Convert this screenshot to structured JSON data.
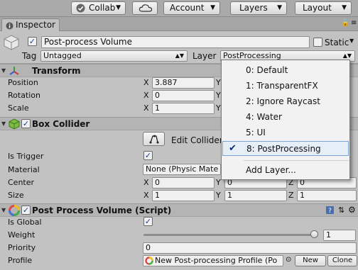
{
  "toolbar": {
    "collab_label": "Collab",
    "account_label": "Account",
    "layers_label": "Layers",
    "layout_label": "Layout"
  },
  "tab": {
    "label": "Inspector"
  },
  "object": {
    "name": "Post-process Volume",
    "static_label": "Static",
    "tag_label": "Tag",
    "tag_value": "Untagged",
    "layer_label": "Layer",
    "layer_value": "PostProcessing"
  },
  "transform": {
    "title": "Transform",
    "position_label": "Position",
    "rotation_label": "Rotation",
    "scale_label": "Scale",
    "x_axis": "X",
    "y_axis": "Y",
    "position_x": "3.887",
    "rotation_x": "0",
    "scale_x": "1"
  },
  "box_collider": {
    "title": "Box Collider",
    "edit_label": "Edit Collider",
    "is_trigger_label": "Is Trigger",
    "material_label": "Material",
    "material_value": "None (Physic Mate",
    "center_label": "Center",
    "size_label": "Size",
    "center": [
      "0",
      "0",
      "0"
    ],
    "size": [
      "1",
      "1",
      "1"
    ],
    "axes": [
      "X",
      "Y",
      "Z"
    ]
  },
  "ppv": {
    "title": "Post Process Volume (Script)",
    "is_global_label": "Is Global",
    "weight_label": "Weight",
    "weight_value": "1",
    "weight_fraction": 1.0,
    "priority_label": "Priority",
    "priority_value": "0",
    "profile_label": "Profile",
    "profile_value": "New Post-processing Profile (Po",
    "new_label": "New",
    "clone_label": "Clone"
  },
  "layer_menu": {
    "items": [
      "0: Default",
      "1: TransparentFX",
      "2: Ignore Raycast",
      "4: Water",
      "5: UI",
      "8: PostProcessing"
    ],
    "add_label": "Add Layer...",
    "selected_index": 5
  }
}
